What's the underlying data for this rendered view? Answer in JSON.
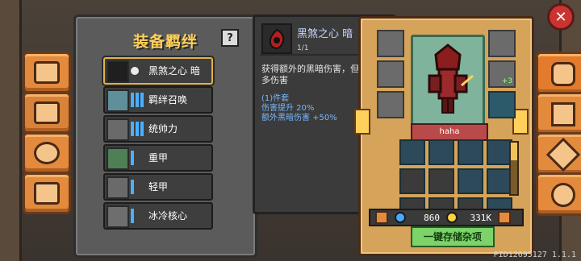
{
  "ui": {
    "close_label": "✕",
    "help_label": "?",
    "build": "PID12695127 1.1.1"
  },
  "set_panel": {
    "title": "装备羁绊",
    "rows": [
      {
        "label": "黑煞之心 暗",
        "icon": "dark-heart-icon",
        "selected": true
      },
      {
        "label": "羁绊召唤",
        "icon": "summon-icon",
        "selected": false
      },
      {
        "label": "统帅力",
        "icon": "leadership-icon",
        "selected": false
      },
      {
        "label": "重甲",
        "icon": "heavy-armor-icon",
        "selected": false
      },
      {
        "label": "轻甲",
        "icon": "light-armor-icon",
        "selected": false
      },
      {
        "label": "冰冷核心",
        "icon": "ice-core-icon",
        "selected": false
      }
    ]
  },
  "description": {
    "name": "黑煞之心 暗",
    "count": "1/1",
    "text": "获得额外的黑暗伤害，但承受更多伤害",
    "bonus_lines": [
      "(1)件套",
      "伤害提升 20%",
      "额外黑暗伤害 +50%"
    ]
  },
  "character": {
    "name": "haha",
    "currencies": [
      {
        "type": "gems",
        "value": "860",
        "color": "#4aa8ff"
      },
      {
        "type": "gold",
        "value": "331K",
        "color": "#ffd33d"
      }
    ],
    "store_button": "一键存储杂项",
    "equip_badge": "+3"
  },
  "colors": {
    "title": "#ffd15a",
    "accent_orange": "#e48a3c",
    "bonus_blue": "#78b7ff",
    "name_bg": "#b94a4a"
  },
  "icons": {
    "left_tabs": [
      "book-icon",
      "chest-icon",
      "paw-icon",
      "bag-icon"
    ],
    "right_tabs": [
      "helmet-icon",
      "skills-icon",
      "shuriken-icon",
      "gear-icon"
    ]
  }
}
